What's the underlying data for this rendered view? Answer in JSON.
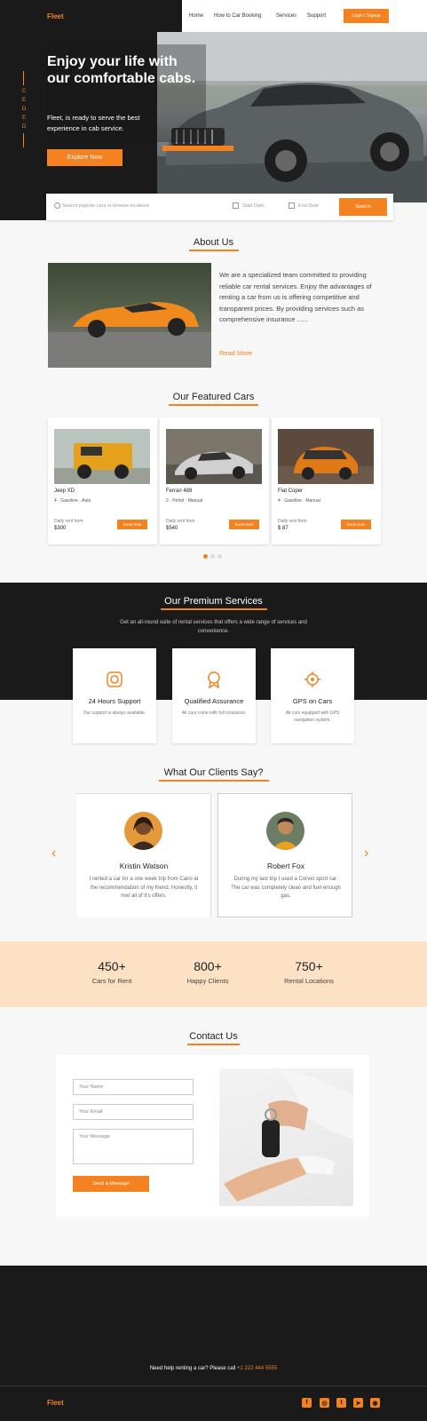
{
  "brand": {
    "logo": "Fleet",
    "accent": "#f58220",
    "dark": "#1a1a1a"
  },
  "nav": {
    "links": [
      "Home",
      "How to Car Booking",
      "Services",
      "Support"
    ],
    "cta": "Login / Signup"
  },
  "side_letters": [
    "C",
    "E",
    "O",
    "E",
    "O"
  ],
  "hero": {
    "title": "Enjoy your life with our comfortable cabs.",
    "subtitle": "Fleet, is ready to serve the best experience in cab service.",
    "cta": "Explore Now"
  },
  "search": {
    "placeholder": "Search popular cars or browse locations",
    "start_date": "Start Date",
    "end_date": "End Date",
    "button": "Search"
  },
  "about": {
    "title": "About Us",
    "text": "We are a specialized team committed to providing reliable car rental services. Enjoy the advantages of renting a car from us is offering competitive and transparent prices. By providing services such as comprehensive insurance ......",
    "more": "Read More"
  },
  "featured": {
    "title": "Our Featured Cars",
    "cars": [
      {
        "name": "Jeep XD",
        "specs": "4 · Gasoline · Auto",
        "daily": "Daily rent from",
        "price": "$300",
        "button": "Book Now",
        "color": "#e6a11a"
      },
      {
        "name": "Ferrari 488",
        "specs": "2 · Petrol · Manual",
        "daily": "Daily rent from",
        "price": "$540",
        "button": "Book Now",
        "color": "#c8c8c8"
      },
      {
        "name": "Fiat Coper",
        "specs": "4 · Gasoline · Manual",
        "daily": "Daily rent from",
        "price": "$ 87",
        "button": "Book Now",
        "color": "#e07a16"
      }
    ]
  },
  "services": {
    "title": "Our Premium Services",
    "desc": "Get an all-round suite of rental services that offers a wide range of services and convenience.",
    "items": [
      {
        "title": "24 Hours Support",
        "desc": "Our support is always available.",
        "icon": "headset-icon"
      },
      {
        "title": "Qualified Assurance",
        "desc": "All cars come with full insurance.",
        "icon": "badge-icon"
      },
      {
        "title": "GPS on Cars",
        "desc": "All cars equipped with GPS navigation system.",
        "icon": "gps-icon"
      }
    ]
  },
  "testimonials": {
    "title": "What Our Clients Say?",
    "items": [
      {
        "name": "Kristin Watson",
        "text": "I rented a car for a one week trip from Cairo at the recommendation of my friend. Honestly, it met all of it's offers."
      },
      {
        "name": "Robert Fox",
        "text": "During my last trip I used a Corvet sport car. The car was completely clean and fuel enough gas."
      }
    ]
  },
  "stats": [
    {
      "num": "450+",
      "label": "Cars for Rent"
    },
    {
      "num": "800+",
      "label": "Happy Clients"
    },
    {
      "num": "750+",
      "label": "Rental Locations"
    }
  ],
  "contact": {
    "title": "Contact Us",
    "name_placeholder": "Your Name",
    "email_placeholder": "Your Email",
    "message_placeholder": "Your Message",
    "button": "Send a Message"
  },
  "footer": {
    "newsletter": "Need help renting a car? Please call",
    "phone": "+1 222 444 5555",
    "logo": "Fleet",
    "socials": [
      "facebook-icon",
      "instagram-icon",
      "twitter-icon",
      "telegram-icon",
      "whatsapp-icon"
    ]
  }
}
